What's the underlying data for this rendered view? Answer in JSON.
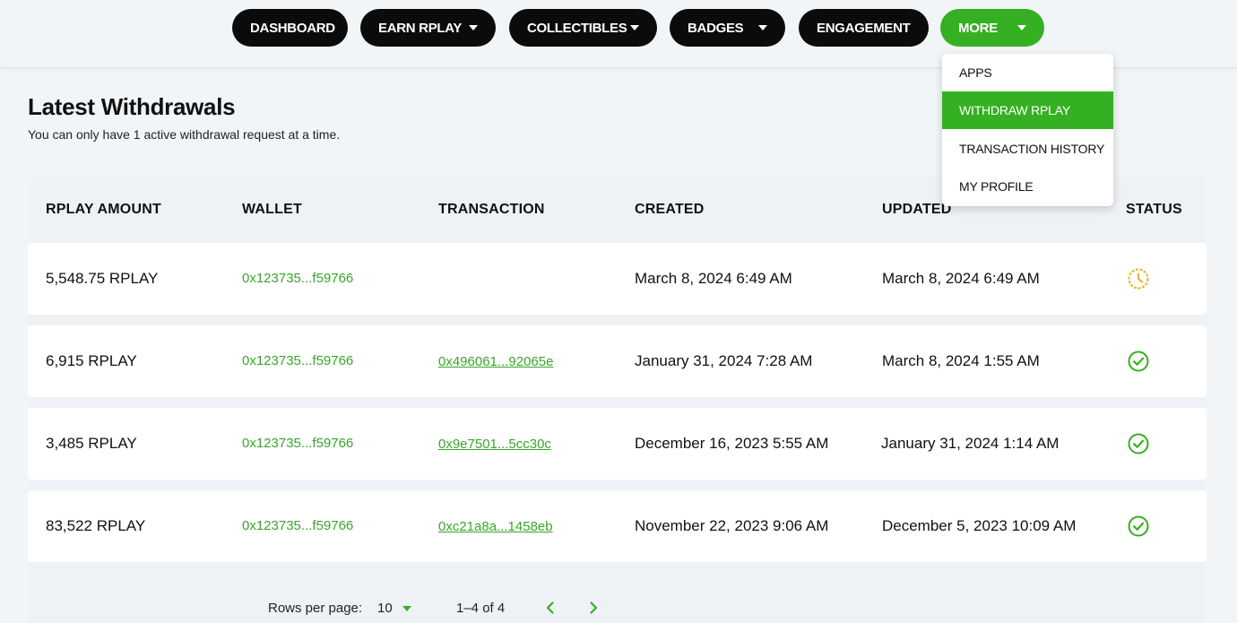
{
  "nav": {
    "dashboard": "DASHBOARD",
    "earn": "EARN RPLAY",
    "collectibles": "COLLECTIBLES",
    "badges": "BADGES",
    "engagement": "ENGAGEMENT",
    "more": "MORE"
  },
  "more_menu": {
    "items": [
      "APPS",
      "WITHDRAW RPLAY",
      "TRANSACTION HISTORY",
      "MY PROFILE"
    ],
    "active_index": 1
  },
  "page": {
    "title": "Latest Withdrawals",
    "subtitle": "You can only have 1 active withdrawal request at a time."
  },
  "table": {
    "headers": [
      "RPLAY AMOUNT",
      "WALLET",
      "TRANSACTION",
      "CREATED",
      "UPDATED",
      "STATUS"
    ],
    "rows": [
      {
        "amount": "5,548.75 RPLAY",
        "wallet": "0x123735...f59766",
        "transaction": "",
        "created": "March 8, 2024 6:49 AM",
        "updated": "March 8, 2024 6:49 AM",
        "status": "pending-clock-icon"
      },
      {
        "amount": "6,915 RPLAY",
        "wallet": "0x123735...f59766",
        "transaction": "0x496061...92065e",
        "created": "January 31, 2024 7:28 AM",
        "updated": "March 8, 2024 1:55 AM",
        "status": "completed-check-icon"
      },
      {
        "amount": "3,485 RPLAY",
        "wallet": "0x123735...f59766",
        "transaction": "0x9e7501...5cc30c",
        "created": "December 16, 2023 5:55 AM",
        "updated": "January 31, 2024 1:14 AM",
        "status": "completed-check-icon"
      },
      {
        "amount": "83,522 RPLAY",
        "wallet": "0x123735...f59766",
        "transaction": "0xc21a8a...1458eb",
        "created": "November 22, 2023 9:06 AM",
        "updated": "December 5, 2023 10:09 AM",
        "status": "completed-check-icon"
      }
    ]
  },
  "pagination": {
    "rows_per_page_label": "Rows per page:",
    "rows_per_page_value": "10",
    "range": "1–4 of 4"
  },
  "colors": {
    "accent_green": "#35b022",
    "link_green": "#3aa52b",
    "pending_yellow": "#e0b52a",
    "nav_black": "#0b0b0b"
  }
}
